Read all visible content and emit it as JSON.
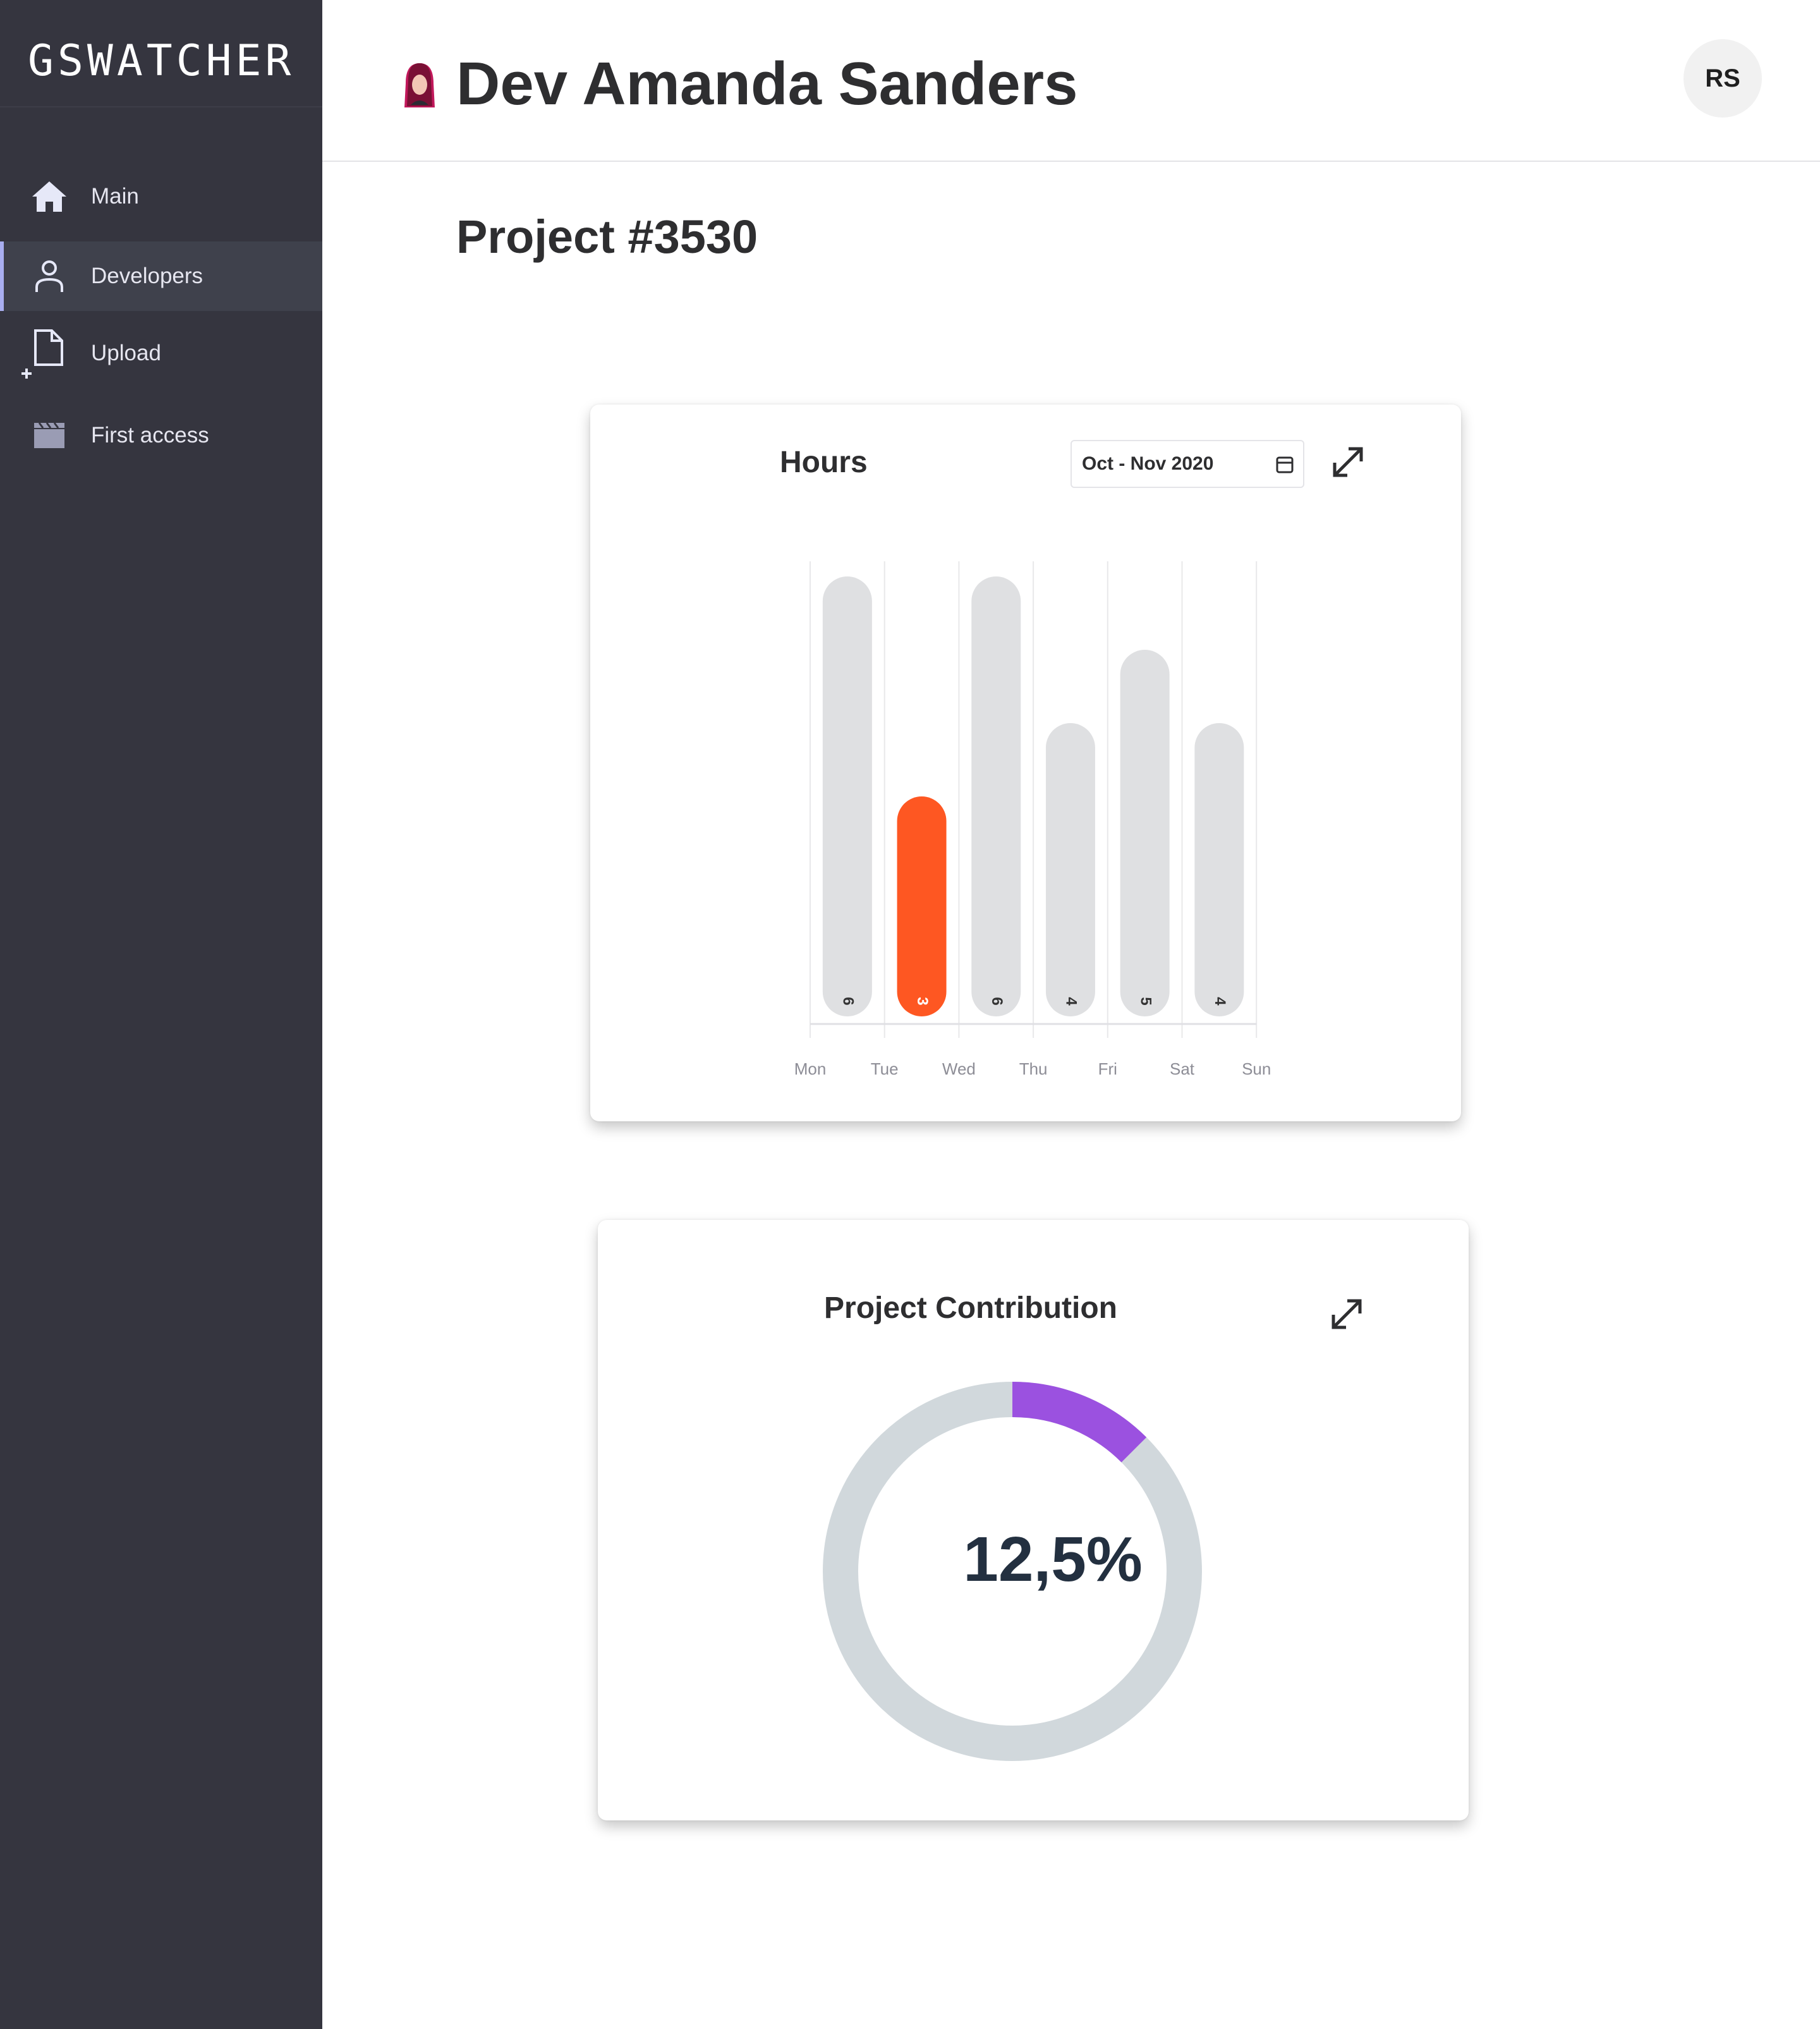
{
  "sidebar": {
    "logo": "GSWATCHER",
    "items": [
      {
        "label": "Main",
        "icon": "home-icon",
        "active": false
      },
      {
        "label": "Developers",
        "icon": "user-icon",
        "active": true
      },
      {
        "label": "Upload",
        "icon": "upload-file-icon",
        "active": false
      },
      {
        "label": "First access",
        "icon": "clapperboard-icon",
        "active": false
      }
    ]
  },
  "header": {
    "developer_name": "Dev Amanda Sanders",
    "user_initials": "RS"
  },
  "project": {
    "title": "Project #3530"
  },
  "hours_card": {
    "title": "Hours",
    "date_range": "Oct - Nov 2020"
  },
  "contribution_card": {
    "title": "Project Contribution",
    "value_label": "12,5%"
  },
  "colors": {
    "sidebar_bg": "#35353f",
    "bar_default": "#dfe0e2",
    "bar_highlight": "#fe5722",
    "donut_track": "#d1d8dc",
    "donut_fill": "#9b51e0"
  },
  "chart_data": [
    {
      "type": "bar",
      "title": "Hours",
      "categories": [
        "Mon",
        "Tue",
        "Wed",
        "Thu",
        "Fri",
        "Sat",
        "Sun"
      ],
      "series": [
        {
          "values": [
            6,
            3,
            6,
            4,
            5,
            4
          ]
        }
      ],
      "highlight_index": 1,
      "ylim": [
        0,
        6
      ],
      "grid": true,
      "bar_labels_rotated": true
    },
    {
      "type": "pie",
      "title": "Project Contribution",
      "values": [
        12.5,
        87.5
      ],
      "display_value": "12,5%"
    }
  ]
}
